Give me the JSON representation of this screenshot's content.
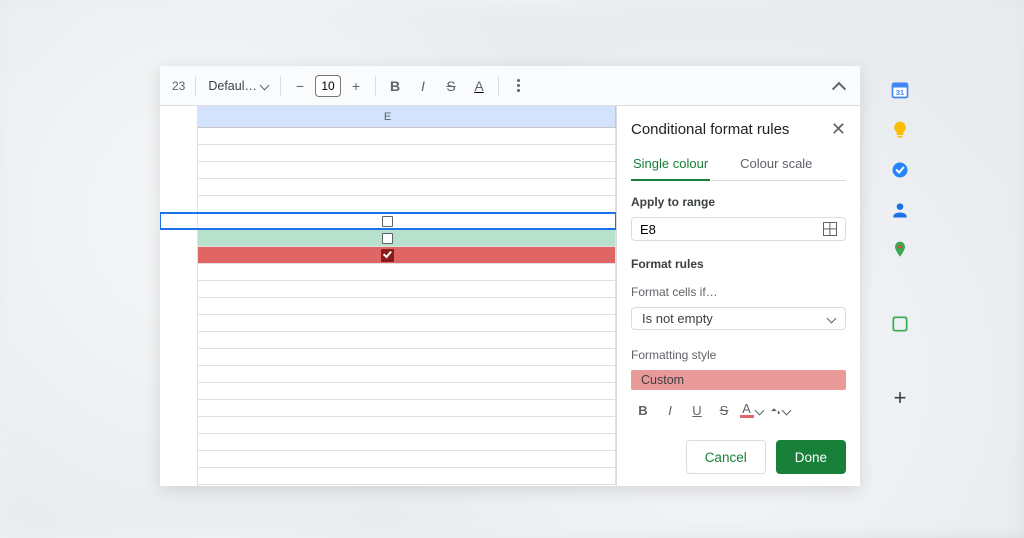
{
  "toolbar": {
    "percent_fragment": "23",
    "font_name": "Defaul…",
    "font_size": "10",
    "bold": "B",
    "italic": "I",
    "strike": "S",
    "text_color_glyph": "A"
  },
  "grid": {
    "column_letter": "E"
  },
  "panel": {
    "title": "Conditional format rules",
    "tab_single": "Single colour",
    "tab_scale": "Colour scale",
    "apply_label": "Apply to range",
    "range_value": "E8",
    "rules_heading": "Format rules",
    "cells_if_label": "Format cells if…",
    "condition_value": "Is not empty",
    "style_label": "Formatting style",
    "style_name": "Custom",
    "style_bold": "B",
    "style_italic": "I",
    "style_underline": "U",
    "style_strike": "S",
    "style_textcolor": "A",
    "cancel": "Cancel",
    "done": "Done"
  },
  "colors": {
    "accent_green": "#188038",
    "row_red": "#e06666",
    "row_green": "#b7e1cd",
    "selection_blue": "#1a73e8"
  }
}
